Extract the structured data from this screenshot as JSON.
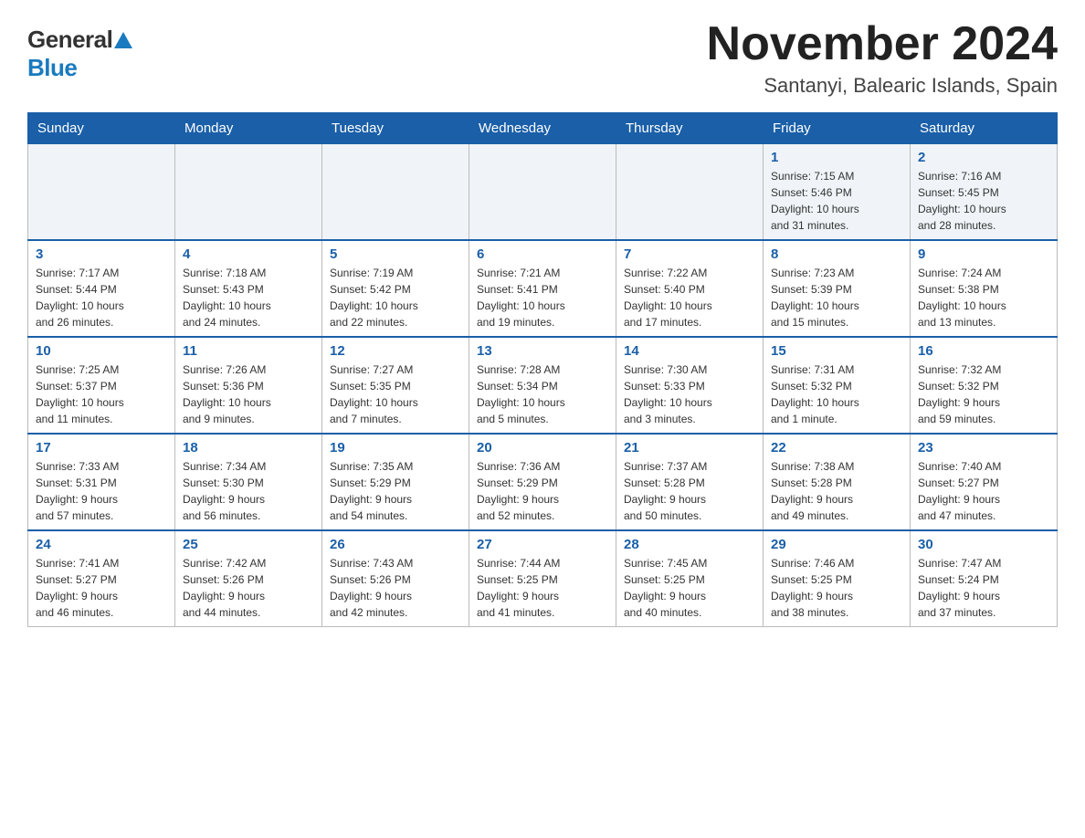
{
  "header": {
    "logo_general": "General",
    "logo_blue": "Blue",
    "month_title": "November 2024",
    "location": "Santanyi, Balearic Islands, Spain"
  },
  "weekdays": [
    "Sunday",
    "Monday",
    "Tuesday",
    "Wednesday",
    "Thursday",
    "Friday",
    "Saturday"
  ],
  "weeks": [
    [
      {
        "day": "",
        "info": ""
      },
      {
        "day": "",
        "info": ""
      },
      {
        "day": "",
        "info": ""
      },
      {
        "day": "",
        "info": ""
      },
      {
        "day": "",
        "info": ""
      },
      {
        "day": "1",
        "info": "Sunrise: 7:15 AM\nSunset: 5:46 PM\nDaylight: 10 hours\nand 31 minutes."
      },
      {
        "day": "2",
        "info": "Sunrise: 7:16 AM\nSunset: 5:45 PM\nDaylight: 10 hours\nand 28 minutes."
      }
    ],
    [
      {
        "day": "3",
        "info": "Sunrise: 7:17 AM\nSunset: 5:44 PM\nDaylight: 10 hours\nand 26 minutes."
      },
      {
        "day": "4",
        "info": "Sunrise: 7:18 AM\nSunset: 5:43 PM\nDaylight: 10 hours\nand 24 minutes."
      },
      {
        "day": "5",
        "info": "Sunrise: 7:19 AM\nSunset: 5:42 PM\nDaylight: 10 hours\nand 22 minutes."
      },
      {
        "day": "6",
        "info": "Sunrise: 7:21 AM\nSunset: 5:41 PM\nDaylight: 10 hours\nand 19 minutes."
      },
      {
        "day": "7",
        "info": "Sunrise: 7:22 AM\nSunset: 5:40 PM\nDaylight: 10 hours\nand 17 minutes."
      },
      {
        "day": "8",
        "info": "Sunrise: 7:23 AM\nSunset: 5:39 PM\nDaylight: 10 hours\nand 15 minutes."
      },
      {
        "day": "9",
        "info": "Sunrise: 7:24 AM\nSunset: 5:38 PM\nDaylight: 10 hours\nand 13 minutes."
      }
    ],
    [
      {
        "day": "10",
        "info": "Sunrise: 7:25 AM\nSunset: 5:37 PM\nDaylight: 10 hours\nand 11 minutes."
      },
      {
        "day": "11",
        "info": "Sunrise: 7:26 AM\nSunset: 5:36 PM\nDaylight: 10 hours\nand 9 minutes."
      },
      {
        "day": "12",
        "info": "Sunrise: 7:27 AM\nSunset: 5:35 PM\nDaylight: 10 hours\nand 7 minutes."
      },
      {
        "day": "13",
        "info": "Sunrise: 7:28 AM\nSunset: 5:34 PM\nDaylight: 10 hours\nand 5 minutes."
      },
      {
        "day": "14",
        "info": "Sunrise: 7:30 AM\nSunset: 5:33 PM\nDaylight: 10 hours\nand 3 minutes."
      },
      {
        "day": "15",
        "info": "Sunrise: 7:31 AM\nSunset: 5:32 PM\nDaylight: 10 hours\nand 1 minute."
      },
      {
        "day": "16",
        "info": "Sunrise: 7:32 AM\nSunset: 5:32 PM\nDaylight: 9 hours\nand 59 minutes."
      }
    ],
    [
      {
        "day": "17",
        "info": "Sunrise: 7:33 AM\nSunset: 5:31 PM\nDaylight: 9 hours\nand 57 minutes."
      },
      {
        "day": "18",
        "info": "Sunrise: 7:34 AM\nSunset: 5:30 PM\nDaylight: 9 hours\nand 56 minutes."
      },
      {
        "day": "19",
        "info": "Sunrise: 7:35 AM\nSunset: 5:29 PM\nDaylight: 9 hours\nand 54 minutes."
      },
      {
        "day": "20",
        "info": "Sunrise: 7:36 AM\nSunset: 5:29 PM\nDaylight: 9 hours\nand 52 minutes."
      },
      {
        "day": "21",
        "info": "Sunrise: 7:37 AM\nSunset: 5:28 PM\nDaylight: 9 hours\nand 50 minutes."
      },
      {
        "day": "22",
        "info": "Sunrise: 7:38 AM\nSunset: 5:28 PM\nDaylight: 9 hours\nand 49 minutes."
      },
      {
        "day": "23",
        "info": "Sunrise: 7:40 AM\nSunset: 5:27 PM\nDaylight: 9 hours\nand 47 minutes."
      }
    ],
    [
      {
        "day": "24",
        "info": "Sunrise: 7:41 AM\nSunset: 5:27 PM\nDaylight: 9 hours\nand 46 minutes."
      },
      {
        "day": "25",
        "info": "Sunrise: 7:42 AM\nSunset: 5:26 PM\nDaylight: 9 hours\nand 44 minutes."
      },
      {
        "day": "26",
        "info": "Sunrise: 7:43 AM\nSunset: 5:26 PM\nDaylight: 9 hours\nand 42 minutes."
      },
      {
        "day": "27",
        "info": "Sunrise: 7:44 AM\nSunset: 5:25 PM\nDaylight: 9 hours\nand 41 minutes."
      },
      {
        "day": "28",
        "info": "Sunrise: 7:45 AM\nSunset: 5:25 PM\nDaylight: 9 hours\nand 40 minutes."
      },
      {
        "day": "29",
        "info": "Sunrise: 7:46 AM\nSunset: 5:25 PM\nDaylight: 9 hours\nand 38 minutes."
      },
      {
        "day": "30",
        "info": "Sunrise: 7:47 AM\nSunset: 5:24 PM\nDaylight: 9 hours\nand 37 minutes."
      }
    ]
  ]
}
